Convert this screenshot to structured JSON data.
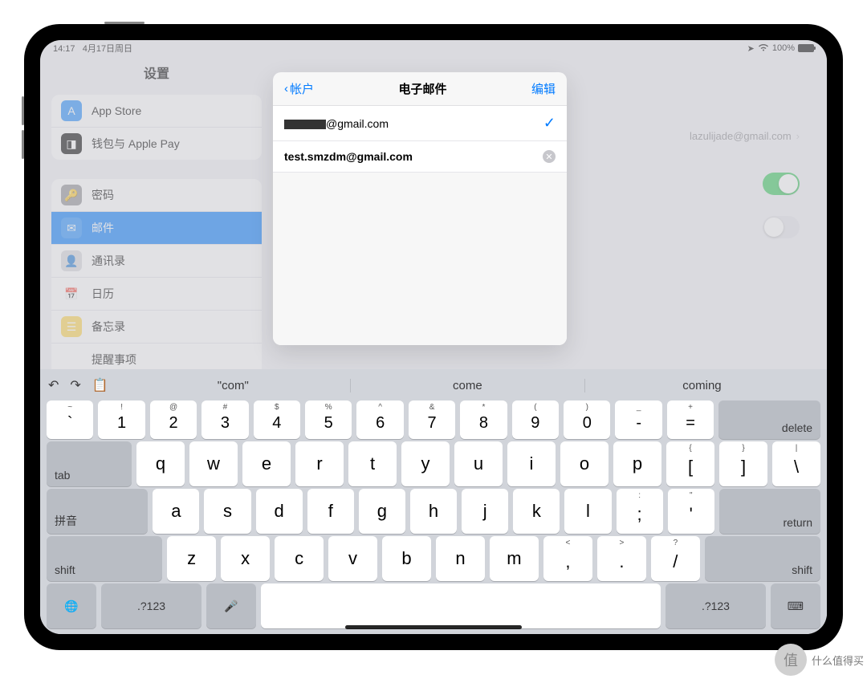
{
  "status": {
    "time": "14:17",
    "date": "4月17日周日",
    "battery": "100%"
  },
  "sidebar": {
    "title": "设置",
    "group1": [
      {
        "label": "App Store",
        "icon_bg": "#1f8cff",
        "glyph": "A",
        "name": "app-store"
      },
      {
        "label": "钱包与 Apple Pay",
        "icon_bg": "#000",
        "glyph": "◨",
        "name": "wallet"
      }
    ],
    "group2": [
      {
        "label": "密码",
        "icon_bg": "#8e8e93",
        "glyph": "🔑",
        "name": "passwords"
      },
      {
        "label": "邮件",
        "icon_bg": "#1f8cff",
        "glyph": "✉",
        "name": "mail",
        "selected": true
      },
      {
        "label": "通讯录",
        "icon_bg": "#d7d7dc",
        "glyph": "👤",
        "name": "contacts"
      },
      {
        "label": "日历",
        "icon_bg": "#fff",
        "glyph": "📅",
        "name": "calendar"
      },
      {
        "label": "备忘录",
        "icon_bg": "#ffd54a",
        "glyph": "☰",
        "name": "notes"
      },
      {
        "label": "提醒事项",
        "icon_bg": "#fff",
        "glyph": "⋮",
        "name": "reminders"
      }
    ]
  },
  "right": {
    "account_hint": "lazulijade@gmail.com"
  },
  "modal": {
    "back": "帐户",
    "title": "电子邮件",
    "edit": "编辑",
    "row_primary_suffix": "@gmail.com",
    "row_input": "test.smzdm@gmail.com"
  },
  "keyboard": {
    "sugg": [
      "\"com\"",
      "come",
      "coming"
    ],
    "numrow": [
      [
        "~",
        "`"
      ],
      [
        "!",
        "1"
      ],
      [
        "@",
        "2"
      ],
      [
        "#",
        "3"
      ],
      [
        "$",
        "4"
      ],
      [
        "%",
        "5"
      ],
      [
        "^",
        "6"
      ],
      [
        "&",
        "7"
      ],
      [
        "*",
        "8"
      ],
      [
        "(",
        "9"
      ],
      [
        ")",
        "0"
      ],
      [
        "_",
        "-"
      ],
      [
        "+",
        "="
      ]
    ],
    "delete": "delete",
    "tab": "tab",
    "row2": [
      "q",
      "w",
      "e",
      "r",
      "t",
      "y",
      "u",
      "i",
      "o",
      "p"
    ],
    "row2end": [
      [
        "{",
        "["
      ],
      [
        "}",
        "]"
      ],
      [
        "|",
        "\\"
      ]
    ],
    "ime": "拼音",
    "row3": [
      "a",
      "s",
      "d",
      "f",
      "g",
      "h",
      "j",
      "k",
      "l"
    ],
    "row3end": [
      [
        ":",
        ";"
      ],
      [
        "\"",
        "'"
      ]
    ],
    "return": "return",
    "shift": "shift",
    "row4": [
      "z",
      "x",
      "c",
      "v",
      "b",
      "n",
      "m"
    ],
    "row4end": [
      [
        "<",
        ","
      ],
      [
        ">",
        "."
      ],
      [
        "?",
        "/"
      ]
    ],
    "sym": ".?123"
  },
  "watermark": {
    "char": "值",
    "text": "什么值得买"
  }
}
